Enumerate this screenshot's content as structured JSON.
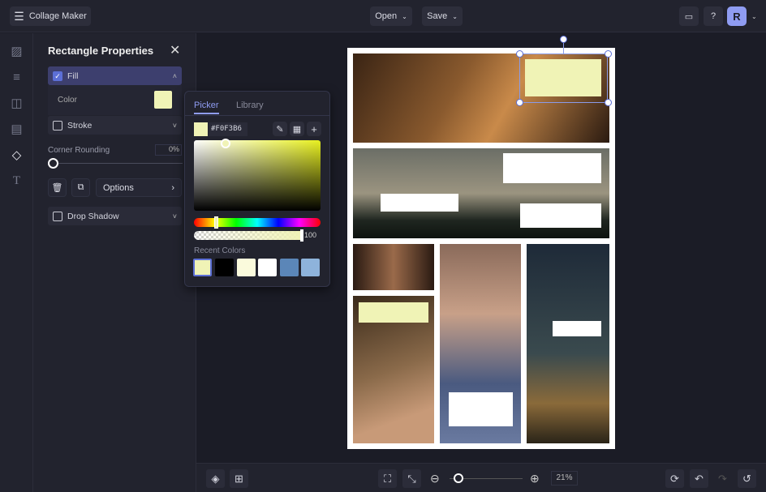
{
  "app": {
    "title": "Collage Maker",
    "open_label": "Open",
    "save_label": "Save",
    "avatar_initial": "R"
  },
  "panel": {
    "title": "Rectangle Properties",
    "fill_label": "Fill",
    "fill_checked": true,
    "color_label": "Color",
    "stroke_label": "Stroke",
    "corner_label": "Corner Rounding",
    "corner_value": "0%",
    "options_label": "Options",
    "shadow_label": "Drop Shadow"
  },
  "picker": {
    "tabs": [
      "Picker",
      "Library"
    ],
    "active_tab": "Picker",
    "hex": "#F0F3B6",
    "opacity": "100",
    "recent_label": "Recent Colors",
    "recent_colors": [
      "#F0F3B6",
      "#000000",
      "#FAFADC",
      "#FFFFFF",
      "#5B86B8",
      "#8EB3DB"
    ]
  },
  "bottom": {
    "zoom": "21%"
  },
  "colors": {
    "accent": "#5c6fd6",
    "fill": "#F0F3B6"
  }
}
